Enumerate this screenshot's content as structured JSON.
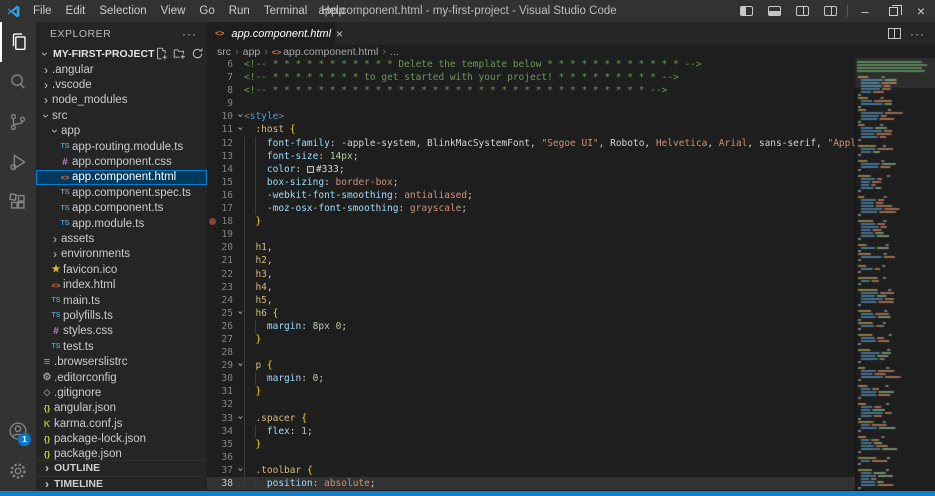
{
  "window": {
    "title": "app.component.html - my-first-project - Visual Studio Code",
    "menus": [
      "File",
      "Edit",
      "Selection",
      "View",
      "Go",
      "Run",
      "Terminal",
      "Help"
    ],
    "controls": [
      "toggle-primary-sidebar",
      "toggle-panel",
      "toggle-secondary-sidebar",
      "customize-layout",
      "minimize",
      "restore",
      "close"
    ]
  },
  "activity_bar": {
    "items": [
      {
        "name": "explorer",
        "active": true
      },
      {
        "name": "search",
        "active": false
      },
      {
        "name": "source-control",
        "active": false
      },
      {
        "name": "run-debug",
        "active": false
      },
      {
        "name": "extensions",
        "active": false
      }
    ],
    "bottom_items": [
      {
        "name": "accounts",
        "badge": "1"
      },
      {
        "name": "settings"
      }
    ]
  },
  "sidebar": {
    "header": "EXPLORER",
    "more_label": "···",
    "project": "MY-FIRST-PROJECT",
    "actions": [
      "new-file-icon",
      "new-folder-icon",
      "refresh-icon",
      "collapse-all-icon"
    ],
    "items": [
      {
        "label": ".angular",
        "kind": "folder",
        "expanded": false,
        "indent": 0
      },
      {
        "label": ".vscode",
        "kind": "folder",
        "expanded": false,
        "indent": 0
      },
      {
        "label": "node_modules",
        "kind": "folder",
        "expanded": false,
        "indent": 0
      },
      {
        "label": "src",
        "kind": "folder",
        "expanded": true,
        "indent": 0
      },
      {
        "label": "app",
        "kind": "folder",
        "expanded": true,
        "indent": 1
      },
      {
        "label": "app-routing.module.ts",
        "icon": "ts",
        "indent": 2
      },
      {
        "label": "app.component.css",
        "icon": "css",
        "indent": 2
      },
      {
        "label": "app.component.html",
        "icon": "html",
        "indent": 2,
        "selected": true
      },
      {
        "label": "app.component.spec.ts",
        "icon": "ts",
        "indent": 2
      },
      {
        "label": "app.component.ts",
        "icon": "ts",
        "indent": 2
      },
      {
        "label": "app.module.ts",
        "icon": "ts",
        "indent": 2
      },
      {
        "label": "assets",
        "kind": "folder",
        "expanded": false,
        "indent": 1
      },
      {
        "label": "environments",
        "kind": "folder",
        "expanded": false,
        "indent": 1
      },
      {
        "label": "favicon.ico",
        "icon": "star",
        "indent": 1
      },
      {
        "label": "index.html",
        "icon": "html",
        "indent": 1
      },
      {
        "label": "main.ts",
        "icon": "ts",
        "indent": 1
      },
      {
        "label": "polyfills.ts",
        "icon": "ts",
        "indent": 1
      },
      {
        "label": "styles.css",
        "icon": "css",
        "indent": 1
      },
      {
        "label": "test.ts",
        "icon": "ts",
        "indent": 1
      },
      {
        "label": ".browserslistrc",
        "icon": "list",
        "indent": 0
      },
      {
        "label": ".editorconfig",
        "icon": "gear",
        "indent": 0
      },
      {
        "label": ".gitignore",
        "icon": "diamond",
        "indent": 0
      },
      {
        "label": "angular.json",
        "icon": "json",
        "indent": 0
      },
      {
        "label": "karma.conf.js",
        "icon": "karma",
        "indent": 0
      },
      {
        "label": "package-lock.json",
        "icon": "json",
        "indent": 0
      },
      {
        "label": "package.json",
        "icon": "json",
        "indent": 0
      }
    ],
    "sections": [
      "OUTLINE",
      "TIMELINE"
    ]
  },
  "editor": {
    "tab": {
      "label": "app.component.html",
      "close": "×"
    },
    "breadcrumb": [
      {
        "label": "src"
      },
      {
        "label": "app"
      },
      {
        "label": "app.component.html",
        "icon": "html"
      },
      {
        "label": "..."
      }
    ],
    "code": {
      "lines": [
        {
          "n": 6,
          "g": [],
          "t": [
            [
              "cm",
              "<!-- * * * * * * * * * * * Delete the template below * * * * * * * * * * * * -->"
            ]
          ]
        },
        {
          "n": 7,
          "g": [],
          "t": [
            [
              "cm",
              "<!-- * * * * * * * * to get started with your project! * * * * * * * * * -->"
            ]
          ]
        },
        {
          "n": 8,
          "g": [],
          "t": [
            [
              "cm",
              "<!-- * * * * * * * * * * * * * * * * * * * * * * * * * * * * * * * * * -->"
            ]
          ]
        },
        {
          "n": 9,
          "g": [],
          "t": []
        },
        {
          "n": 10,
          "fold": true,
          "g": [],
          "t": [
            [
              "pb",
              "<"
            ],
            [
              "tag",
              "style"
            ],
            [
              "pb",
              ">"
            ]
          ]
        },
        {
          "n": 11,
          "fold": true,
          "g": [],
          "t": [
            [
              "pl",
              "  "
            ],
            [
              "se",
              ":host"
            ],
            [
              "pl",
              " "
            ],
            [
              "br",
              "{"
            ]
          ]
        },
        {
          "n": 12,
          "g": [
            0,
            2
          ],
          "t": [
            [
              "pl",
              "    "
            ],
            [
              "pr",
              "font-family"
            ],
            [
              "pu",
              ": "
            ],
            [
              "pl",
              "-apple-system, BlinkMacSystemFont, "
            ],
            [
              "st",
              "\"Segoe UI\""
            ],
            [
              "pl",
              ", Roboto, "
            ],
            [
              "st",
              "Helvetica"
            ],
            [
              "pl",
              ", "
            ],
            [
              "st",
              "Arial"
            ],
            [
              "pl",
              ", sans-serif, "
            ],
            [
              "st",
              "\"Apple Col"
            ]
          ]
        },
        {
          "n": 13,
          "g": [
            0,
            2
          ],
          "t": [
            [
              "pl",
              "    "
            ],
            [
              "pr",
              "font-size"
            ],
            [
              "pu",
              ": "
            ],
            [
              "nu",
              "14px"
            ],
            [
              "pu",
              ";"
            ]
          ]
        },
        {
          "n": 14,
          "g": [
            0,
            2
          ],
          "t": [
            [
              "pl",
              "    "
            ],
            [
              "pr",
              "color"
            ],
            [
              "pu",
              ": "
            ],
            [
              "sw",
              ""
            ],
            [
              "pl",
              "#333"
            ],
            [
              "pu",
              ";"
            ]
          ]
        },
        {
          "n": 15,
          "g": [
            0,
            2
          ],
          "t": [
            [
              "pl",
              "    "
            ],
            [
              "pr",
              "box-sizing"
            ],
            [
              "pu",
              ": "
            ],
            [
              "st",
              "border-box"
            ],
            [
              "pu",
              ";"
            ]
          ]
        },
        {
          "n": 16,
          "g": [
            0,
            2
          ],
          "t": [
            [
              "pl",
              "    "
            ],
            [
              "pr",
              "-webkit-font-smoothing"
            ],
            [
              "pu",
              ": "
            ],
            [
              "st",
              "antialiased"
            ],
            [
              "pu",
              ";"
            ]
          ]
        },
        {
          "n": 17,
          "g": [
            0,
            2
          ],
          "t": [
            [
              "pl",
              "    "
            ],
            [
              "pr",
              "-moz-osx-font-smoothing"
            ],
            [
              "pu",
              ": "
            ],
            [
              "st",
              "grayscale"
            ],
            [
              "pu",
              ";"
            ]
          ]
        },
        {
          "n": 18,
          "bp": true,
          "g": [
            0
          ],
          "t": [
            [
              "pl",
              "  "
            ],
            [
              "br",
              "}"
            ]
          ]
        },
        {
          "n": 19,
          "g": [
            0
          ],
          "t": []
        },
        {
          "n": 20,
          "g": [
            0
          ],
          "t": [
            [
              "pl",
              "  "
            ],
            [
              "se",
              "h1"
            ],
            [
              "pu",
              ","
            ]
          ]
        },
        {
          "n": 21,
          "g": [
            0
          ],
          "t": [
            [
              "pl",
              "  "
            ],
            [
              "se",
              "h2"
            ],
            [
              "pu",
              ","
            ]
          ]
        },
        {
          "n": 22,
          "g": [
            0
          ],
          "t": [
            [
              "pl",
              "  "
            ],
            [
              "se",
              "h3"
            ],
            [
              "pu",
              ","
            ]
          ]
        },
        {
          "n": 23,
          "g": [
            0
          ],
          "t": [
            [
              "pl",
              "  "
            ],
            [
              "se",
              "h4"
            ],
            [
              "pu",
              ","
            ]
          ]
        },
        {
          "n": 24,
          "g": [
            0
          ],
          "t": [
            [
              "pl",
              "  "
            ],
            [
              "se",
              "h5"
            ],
            [
              "pu",
              ","
            ]
          ]
        },
        {
          "n": 25,
          "fold": true,
          "g": [
            0
          ],
          "t": [
            [
              "pl",
              "  "
            ],
            [
              "se",
              "h6"
            ],
            [
              "pl",
              " "
            ],
            [
              "br",
              "{"
            ]
          ]
        },
        {
          "n": 26,
          "g": [
            0,
            2
          ],
          "t": [
            [
              "pl",
              "    "
            ],
            [
              "pr",
              "margin"
            ],
            [
              "pu",
              ": "
            ],
            [
              "nu",
              "8px"
            ],
            [
              "pl",
              " "
            ],
            [
              "nu",
              "0"
            ],
            [
              "pu",
              ";"
            ]
          ]
        },
        {
          "n": 27,
          "g": [
            0
          ],
          "t": [
            [
              "pl",
              "  "
            ],
            [
              "br",
              "}"
            ]
          ]
        },
        {
          "n": 28,
          "g": [
            0
          ],
          "t": []
        },
        {
          "n": 29,
          "fold": true,
          "g": [
            0
          ],
          "t": [
            [
              "pl",
              "  "
            ],
            [
              "se",
              "p"
            ],
            [
              "pl",
              " "
            ],
            [
              "br",
              "{"
            ]
          ]
        },
        {
          "n": 30,
          "g": [
            0,
            2
          ],
          "t": [
            [
              "pl",
              "    "
            ],
            [
              "pr",
              "margin"
            ],
            [
              "pu",
              ": "
            ],
            [
              "nu",
              "0"
            ],
            [
              "pu",
              ";"
            ]
          ]
        },
        {
          "n": 31,
          "g": [
            0
          ],
          "t": [
            [
              "pl",
              "  "
            ],
            [
              "br",
              "}"
            ]
          ]
        },
        {
          "n": 32,
          "g": [
            0
          ],
          "t": []
        },
        {
          "n": 33,
          "fold": true,
          "g": [
            0
          ],
          "t": [
            [
              "pl",
              "  "
            ],
            [
              "se",
              ".spacer"
            ],
            [
              "pl",
              " "
            ],
            [
              "br",
              "{"
            ]
          ]
        },
        {
          "n": 34,
          "g": [
            0,
            2
          ],
          "t": [
            [
              "pl",
              "    "
            ],
            [
              "pr",
              "flex"
            ],
            [
              "pu",
              ": "
            ],
            [
              "nu",
              "1"
            ],
            [
              "pu",
              ";"
            ]
          ]
        },
        {
          "n": 35,
          "g": [
            0
          ],
          "t": [
            [
              "pl",
              "  "
            ],
            [
              "br",
              "}"
            ]
          ]
        },
        {
          "n": 36,
          "g": [
            0
          ],
          "t": []
        },
        {
          "n": 37,
          "fold": true,
          "g": [
            0
          ],
          "t": [
            [
              "pl",
              "  "
            ],
            [
              "se",
              ".toolbar"
            ],
            [
              "pl",
              " "
            ],
            [
              "br",
              "{"
            ]
          ]
        },
        {
          "n": 38,
          "cur": true,
          "g": [
            0,
            2
          ],
          "t": [
            [
              "pl",
              "    "
            ],
            [
              "pr",
              "position"
            ],
            [
              "pu",
              ": "
            ],
            [
              "st",
              "absolute"
            ],
            [
              "pu",
              ";"
            ]
          ]
        }
      ]
    }
  },
  "colors": {
    "accent": "#007acc",
    "selection_bg": "#04395e",
    "selection_border": "#007fd4",
    "editor_bg": "#1e1e1e",
    "sidebar_bg": "#252526",
    "activitybar_bg": "#333333",
    "titlebar_bg": "#323233",
    "breakpoint": "#8f3d3b"
  }
}
